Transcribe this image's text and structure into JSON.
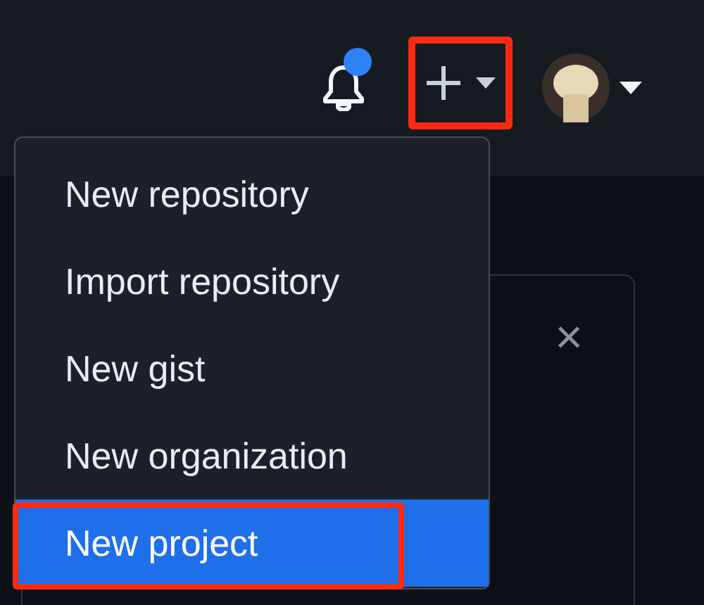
{
  "header": {
    "notifications": {
      "unread": true
    },
    "create_button": {
      "annotated": true
    }
  },
  "menu": {
    "items": [
      {
        "label": "New repository",
        "selected": false,
        "annotated": false
      },
      {
        "label": "Import repository",
        "selected": false,
        "annotated": false
      },
      {
        "label": "New gist",
        "selected": false,
        "annotated": false
      },
      {
        "label": "New organization",
        "selected": false,
        "annotated": false
      },
      {
        "label": "New project",
        "selected": true,
        "annotated": true
      }
    ]
  },
  "dialog": {
    "close": "×"
  }
}
